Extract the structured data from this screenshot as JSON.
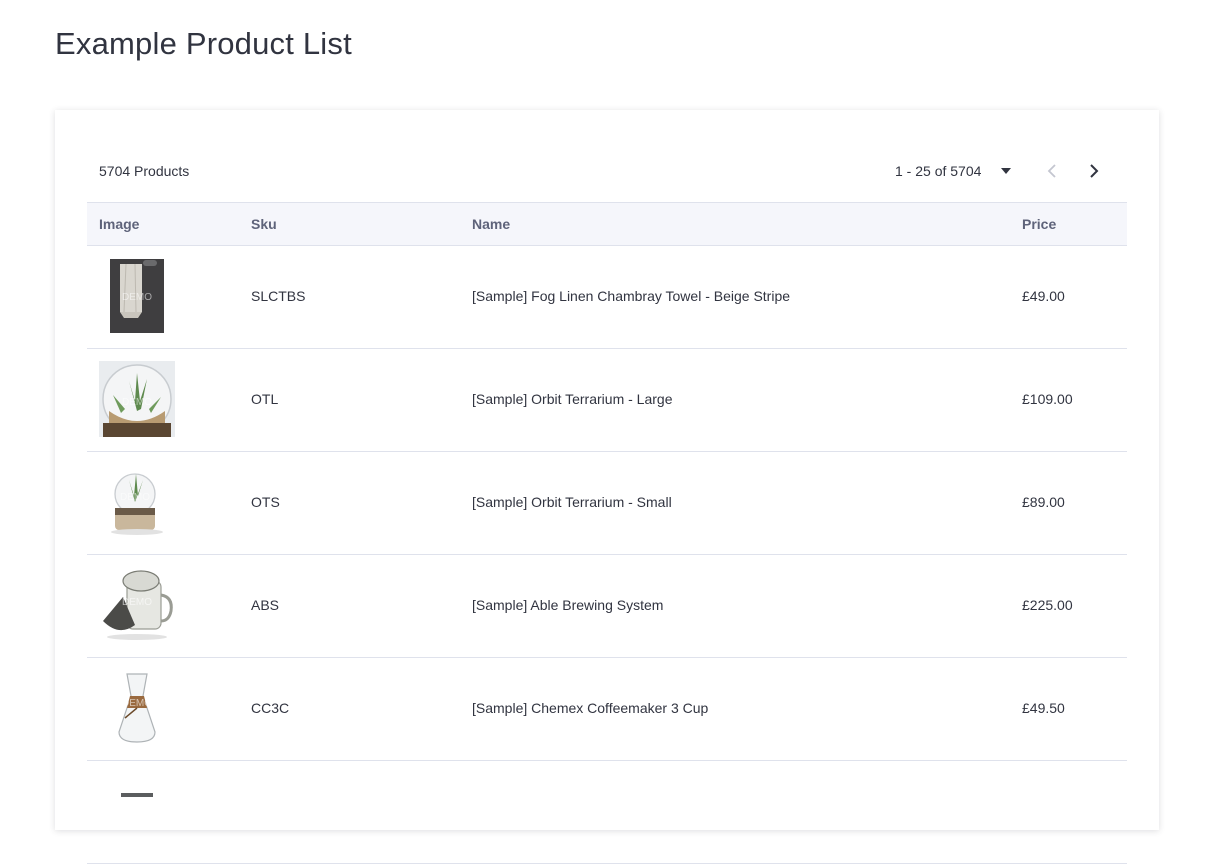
{
  "page": {
    "title": "Example Product List"
  },
  "toolbar": {
    "count_label": "5704 Products",
    "range_label": "1 - 25 of 5704"
  },
  "table": {
    "headers": {
      "image": "Image",
      "sku": "Sku",
      "name": "Name",
      "price": "Price"
    },
    "rows": [
      {
        "image_icon": "towel-product-image",
        "sku": "SLCTBS",
        "name": "[Sample] Fog Linen Chambray Towel - Beige Stripe",
        "price": "£49.00"
      },
      {
        "image_icon": "terrarium-large-product-image",
        "sku": "OTL",
        "name": "[Sample] Orbit Terrarium - Large",
        "price": "£109.00"
      },
      {
        "image_icon": "terrarium-small-product-image",
        "sku": "OTS",
        "name": "[Sample] Orbit Terrarium - Small",
        "price": "£89.00"
      },
      {
        "image_icon": "brewing-system-product-image",
        "sku": "ABS",
        "name": "[Sample] Able Brewing System",
        "price": "£225.00"
      },
      {
        "image_icon": "chemex-product-image",
        "sku": "CC3C",
        "name": "[Sample] Chemex Coffeemaker 3 Cup",
        "price": "£49.50"
      }
    ],
    "image_watermark": "DEMO"
  },
  "colors": {
    "text": "#313440",
    "header_text": "#5e637a",
    "header_bg": "#f5f6fb",
    "border": "#dfe2ec",
    "disabled_icon": "#c4c6d0"
  }
}
